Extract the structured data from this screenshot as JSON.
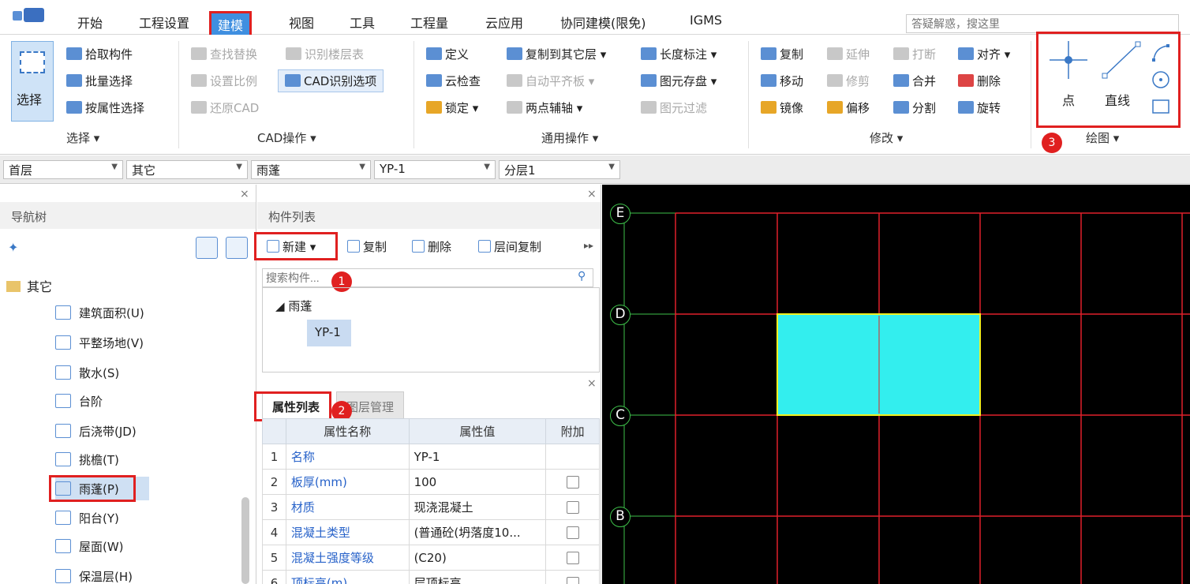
{
  "menu": {
    "items": [
      "开始",
      "工程设置",
      "建模",
      "视图",
      "工具",
      "工程量",
      "云应用",
      "协同建模(限免)",
      "IGMS"
    ],
    "active_index": 2,
    "search_placeholder": "答疑解惑，搜这里"
  },
  "ribbon": {
    "select_group": {
      "big_button": "选择",
      "items": [
        "拾取构件",
        "批量选择",
        "按属性选择"
      ],
      "label": "选择"
    },
    "cad_group": {
      "items": [
        "查找替换",
        "识别楼层表",
        "设置比例",
        "CAD识别选项",
        "还原CAD"
      ],
      "label": "CAD操作"
    },
    "common_group": {
      "items": [
        "定义",
        "复制到其它层",
        "长度标注",
        "云检查",
        "自动平齐板",
        "图元存盘",
        "锁定",
        "两点辅轴",
        "图元过滤"
      ],
      "label": "通用操作"
    },
    "modify_group": {
      "items": [
        "复制",
        "延伸",
        "打断",
        "对齐",
        "移动",
        "修剪",
        "合并",
        "删除",
        "镜像",
        "偏移",
        "分割",
        "旋转"
      ],
      "label": "修改"
    },
    "draw_group": {
      "point": "点",
      "line": "直线",
      "label": "绘图"
    }
  },
  "selectors": {
    "floor": "首层",
    "category": "其它",
    "type": "雨蓬",
    "component": "YP-1",
    "layer": "分层1"
  },
  "nav_tree": {
    "title": "导航树",
    "root": "其它",
    "items": [
      "建筑面积(U)",
      "平整场地(V)",
      "散水(S)",
      "台阶",
      "后浇带(JD)",
      "挑檐(T)",
      "雨蓬(P)",
      "阳台(Y)",
      "屋面(W)",
      "保温层(H)"
    ],
    "selected_index": 6
  },
  "component_list": {
    "title": "构件列表",
    "toolbar": {
      "new": "新建",
      "copy": "复制",
      "delete": "删除",
      "floor_copy": "层间复制"
    },
    "search_placeholder": "搜索构件...",
    "tree_root": "雨蓬",
    "tree_child": "YP-1"
  },
  "property_panel": {
    "tabs": [
      "属性列表",
      "图层管理"
    ],
    "headers": [
      "属性名称",
      "属性值",
      "附加"
    ],
    "rows": [
      {
        "num": "1",
        "name": "名称",
        "value": "YP-1",
        "check": false
      },
      {
        "num": "2",
        "name": "板厚(mm)",
        "value": "100",
        "check": true
      },
      {
        "num": "3",
        "name": "材质",
        "value": "现浇混凝土",
        "check": true
      },
      {
        "num": "4",
        "name": "混凝土类型",
        "value": "(普通砼(坍落度10...",
        "check": true
      },
      {
        "num": "5",
        "name": "混凝土强度等级",
        "value": "(C20)",
        "check": true
      },
      {
        "num": "6",
        "name": "顶标高(m)",
        "value": "层顶标高",
        "check": true
      }
    ]
  },
  "canvas": {
    "axes": [
      "E",
      "D",
      "C",
      "B"
    ]
  },
  "callouts": [
    "1",
    "2",
    "3"
  ],
  "colors": {
    "highlight_red": "#e02020",
    "grid_red": "#e0202a",
    "axis_green": "#3ec04a",
    "slab_fill": "#33eeee",
    "slab_border": "#f0f020"
  }
}
